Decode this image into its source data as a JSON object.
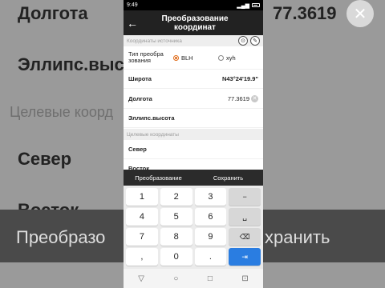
{
  "background": {
    "dolgota": "Долгота",
    "dolgota_value": "77.3619",
    "ellips": "Эллипс.высота",
    "target": "Целевые коорд",
    "sever": "Север",
    "vostok": "Восток",
    "band_left": "Преобразо",
    "band_right": "хранить"
  },
  "status": {
    "time": "9:49",
    "signal": "▂▄▆",
    "battery_icon": "battery-icon"
  },
  "appbar": {
    "back": "←",
    "title_line1": "Преобразование",
    "title_line2": "координат"
  },
  "source": {
    "header": "Координаты источника",
    "icon_location": "⊙",
    "icon_edit": "✎",
    "type_label_line1": "Тип преобра",
    "type_label_line2": "зования",
    "option_blh": "BLH",
    "option_xyh": "xyh",
    "selected": "BLH",
    "rows": [
      {
        "label": "Широта",
        "value": "N43°24'19.9\""
      },
      {
        "label": "Долгота",
        "value": "77.3619"
      },
      {
        "label": "Эллипс.высота",
        "value": ""
      }
    ]
  },
  "target": {
    "header": "Целевые координаты",
    "rows": [
      {
        "label": "Север",
        "value": ""
      },
      {
        "label": "Восток",
        "value": ""
      }
    ]
  },
  "actions": {
    "convert": "Преобразование",
    "save": "Сохранить"
  },
  "keyboard": {
    "rows": [
      [
        "1",
        "2",
        "3",
        "−"
      ],
      [
        "4",
        "5",
        "6",
        "␣"
      ],
      [
        "7",
        "8",
        "9",
        "⌫"
      ],
      [
        ",",
        "0",
        ".",
        "⇥"
      ]
    ]
  },
  "navbar": {
    "back": "▽",
    "home": "○",
    "recents": "□",
    "extra": "⊡"
  }
}
